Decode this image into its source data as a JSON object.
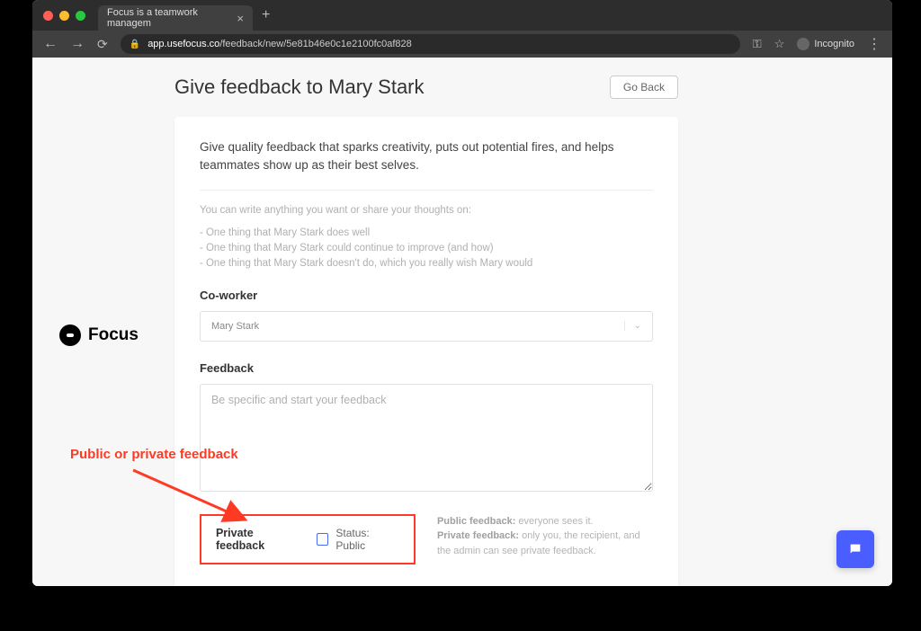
{
  "browser": {
    "tab_title": "Focus is a teamwork managem",
    "url_host": "app.usefocus.co",
    "url_path": "/feedback/new/5e81b46e0c1e2100fc0af828",
    "incognito_label": "Incognito"
  },
  "logo_text": "Focus",
  "page_title": "Give feedback to Mary Stark",
  "go_back_label": "Go Back",
  "intro_text": "Give quality feedback that sparks creativity, puts out potential fires, and helps teammates show up as their best selves.",
  "hints": {
    "intro": "You can write anything you want or share your thoughts on:",
    "items": [
      "- One thing that Mary Stark does well",
      "- One thing that Mary Stark could continue to improve (and how)",
      "- One thing that Mary Stark doesn't do, which you really wish Mary would"
    ]
  },
  "coworker": {
    "label": "Co-worker",
    "selected": "Mary Stark"
  },
  "feedback": {
    "label": "Feedback",
    "placeholder": "Be specific and start your feedback"
  },
  "private": {
    "label": "Private feedback",
    "status": "Status: Public"
  },
  "info": {
    "public_bold": "Public feedback:",
    "public_text": " everyone sees it.",
    "private_bold": "Private feedback:",
    "private_text": " only you, the recipient, and the admin can see private feedback."
  },
  "annotation": "Public or private feedback"
}
